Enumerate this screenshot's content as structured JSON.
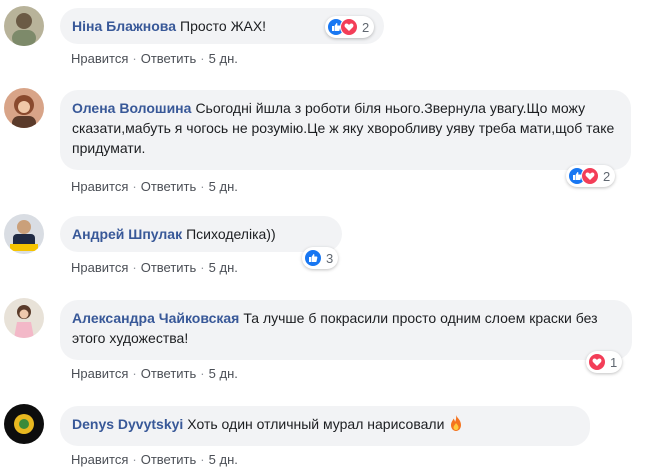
{
  "comments": [
    {
      "author": "Ніна Блажнова",
      "text": "Просто ЖАХ!",
      "actions": {
        "like": "Нравится",
        "reply": "Ответить",
        "time": "5 дн."
      },
      "reactions": {
        "types": [
          "like",
          "love"
        ],
        "count": "2"
      }
    },
    {
      "author": "Олена Волошина",
      "text": "Сьогодні йшла з роботи біля нього.Звернула увагу.Що можу сказати,мабуть я чогось не розумію.Це ж яку хворобливу уяву треба мати,щоб таке придумати.",
      "actions": {
        "like": "Нравится",
        "reply": "Ответить",
        "time": "5 дн."
      },
      "reactions": {
        "types": [
          "like",
          "love"
        ],
        "count": "2"
      }
    },
    {
      "author": "Андрей Шпулак",
      "text": "Психоделіка))",
      "actions": {
        "like": "Нравится",
        "reply": "Ответить",
        "time": "5 дн."
      },
      "reactions": {
        "types": [
          "like"
        ],
        "count": "3"
      }
    },
    {
      "author": "Александра Чайковская",
      "text": "Та лучше б покрасили просто одним слоем краски без этого художества!",
      "actions": {
        "like": "Нравится",
        "reply": "Ответить",
        "time": "5 дн."
      },
      "reactions": {
        "types": [
          "love"
        ],
        "count": "1"
      }
    },
    {
      "author": "Denys Dyvytskyi",
      "text": "Хоть один отличный мурал нарисовали",
      "emoji": "fire-icon",
      "actions": {
        "like": "Нравится",
        "reply": "Ответить",
        "time": "5 дн."
      }
    }
  ],
  "colors": {
    "author": "#385898",
    "bubble": "#f2f3f5",
    "like": "#1877f2",
    "love": "#f33e58"
  }
}
